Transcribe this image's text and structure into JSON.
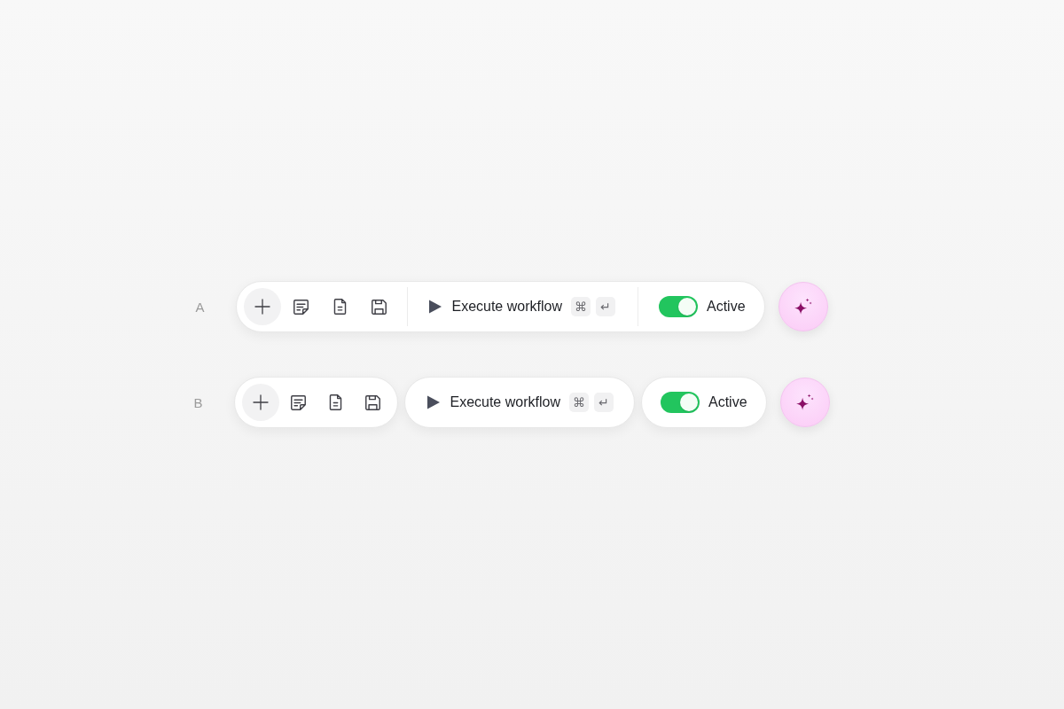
{
  "rows": [
    {
      "label": "A",
      "kind": "joined",
      "execute": {
        "label": "Execute workflow",
        "keys": [
          "⌘",
          "↵"
        ]
      },
      "toggle": {
        "label": "Active",
        "on": true
      }
    },
    {
      "label": "B",
      "kind": "split",
      "execute": {
        "label": "Execute workflow",
        "keys": [
          "⌘",
          "↵"
        ]
      },
      "toggle": {
        "label": "Active",
        "on": true
      }
    }
  ]
}
